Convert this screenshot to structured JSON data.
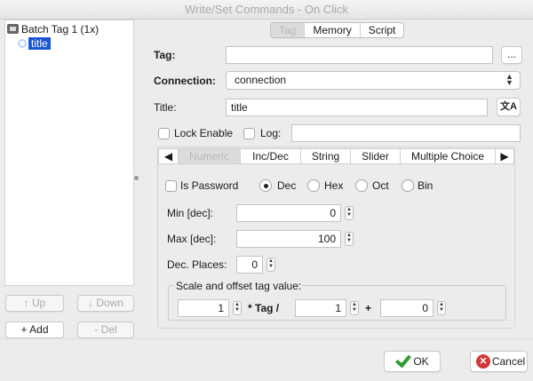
{
  "window": {
    "title": "Write/Set Commands - On Click"
  },
  "tree": {
    "root_label": "Batch Tag 1 (1x)",
    "child_label": "title",
    "buttons": {
      "up": "↑ Up",
      "down": "↓ Down",
      "add": "+ Add",
      "del": "- Del"
    }
  },
  "top_tabs": [
    {
      "label": "Tag",
      "active": true
    },
    {
      "label": "Memory",
      "active": false
    },
    {
      "label": "Script",
      "active": false
    }
  ],
  "form": {
    "tag_label": "Tag:",
    "tag_value": "",
    "browse_button": "...",
    "connection_label": "Connection:",
    "connection_value": "connection",
    "title_label": "Title:",
    "title_value": "title",
    "lock_enable_label": "Lock Enable",
    "log_label": "Log:",
    "log_value": ""
  },
  "sub_tabs": [
    {
      "label": "Numeric",
      "active": true
    },
    {
      "label": "Inc/Dec",
      "active": false
    },
    {
      "label": "String",
      "active": false
    },
    {
      "label": "Slider",
      "active": false
    },
    {
      "label": "Multiple Choice",
      "active": false
    }
  ],
  "numeric": {
    "is_password_label": "Is Password",
    "radios": [
      {
        "label": "Dec",
        "selected": true
      },
      {
        "label": "Hex",
        "selected": false
      },
      {
        "label": "Oct",
        "selected": false
      },
      {
        "label": "Bin",
        "selected": false
      }
    ],
    "min_label": "Min [dec]:",
    "min_value": "0",
    "max_label": "Max [dec]:",
    "max_value": "100",
    "dec_places_label": "Dec. Places:",
    "dec_places_value": "0",
    "scale_group_label": "Scale and offset tag value:",
    "scale_value": "1",
    "times_tag_label": "* Tag  /",
    "divisor_value": "1",
    "plus_label": "+",
    "offset_value": "0"
  },
  "dialog_buttons": {
    "ok": "OK",
    "cancel": "Cancel"
  },
  "colors": {
    "selection": "#1b57d4",
    "ok_check": "#2e9b2e",
    "cancel_red": "#d13838"
  }
}
